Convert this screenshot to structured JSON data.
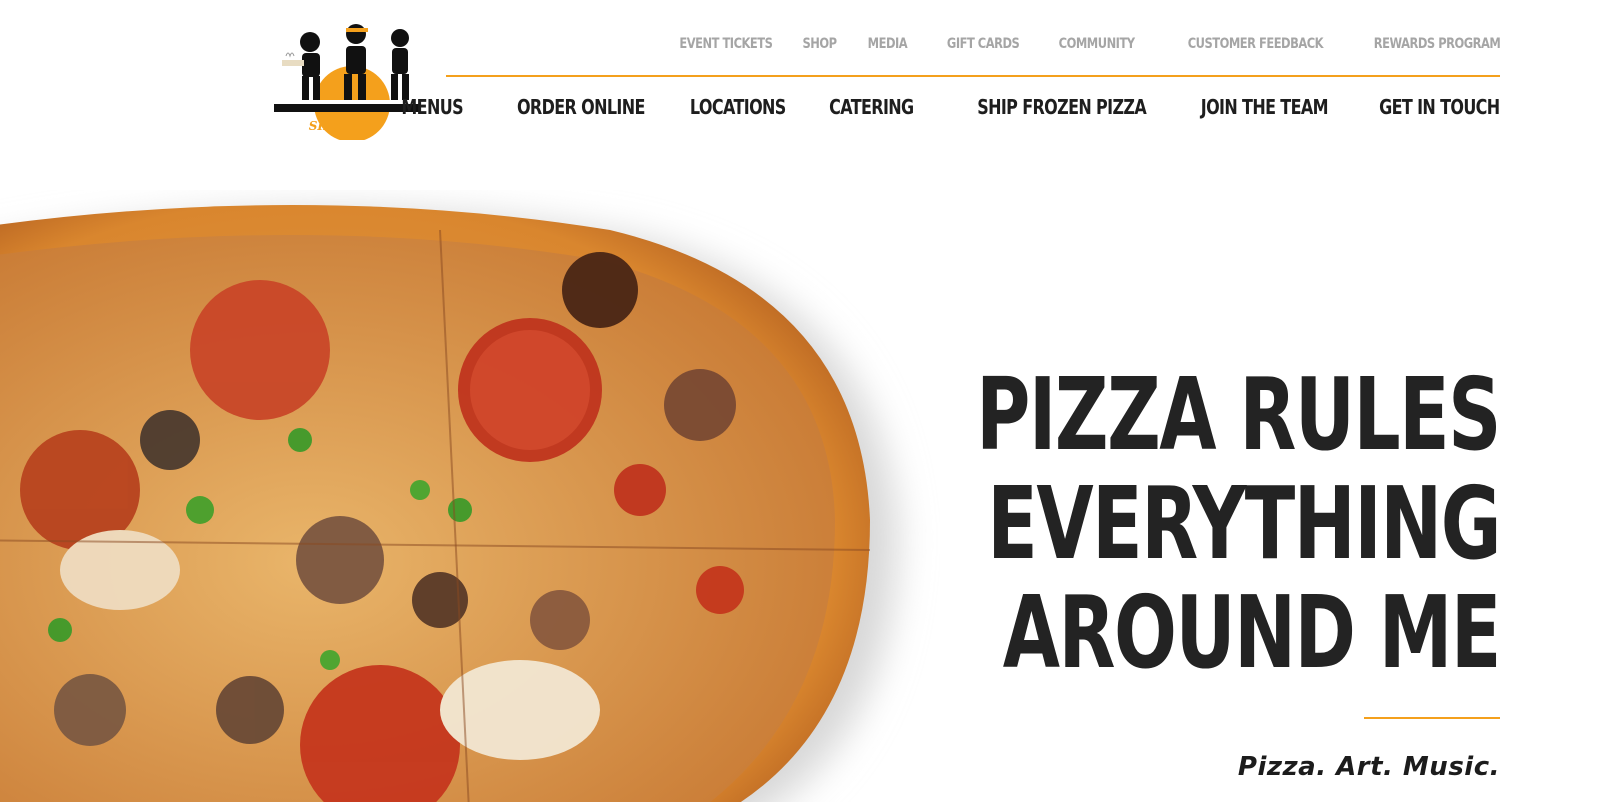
{
  "brand": {
    "logo_icon": "three-cartoon-characters-sun-logo",
    "logo_text": "SH × RPE",
    "accent_color": "#f4a01c"
  },
  "utility_nav": [
    {
      "label": "EVENT TICKETS"
    },
    {
      "label": "SHOP"
    },
    {
      "label": "MEDIA"
    },
    {
      "label": "GIFT CARDS"
    },
    {
      "label": "COMMUNITY"
    },
    {
      "label": "CUSTOMER FEEDBACK"
    },
    {
      "label": "REWARDS PROGRAM"
    }
  ],
  "main_nav": [
    {
      "label": "MENUS"
    },
    {
      "label": "ORDER ONLINE"
    },
    {
      "label": "LOCATIONS"
    },
    {
      "label": "CATERING"
    },
    {
      "label": "SHIP FROZEN PIZZA"
    },
    {
      "label": "JOIN THE TEAM"
    },
    {
      "label": "GET IN TOUCH"
    }
  ],
  "hero": {
    "image_icon": "pizza-photo",
    "headline": [
      "PIZZA RULES",
      "EVERYTHING",
      "AROUND ME"
    ],
    "tagline": "Pizza. Art. Music."
  }
}
